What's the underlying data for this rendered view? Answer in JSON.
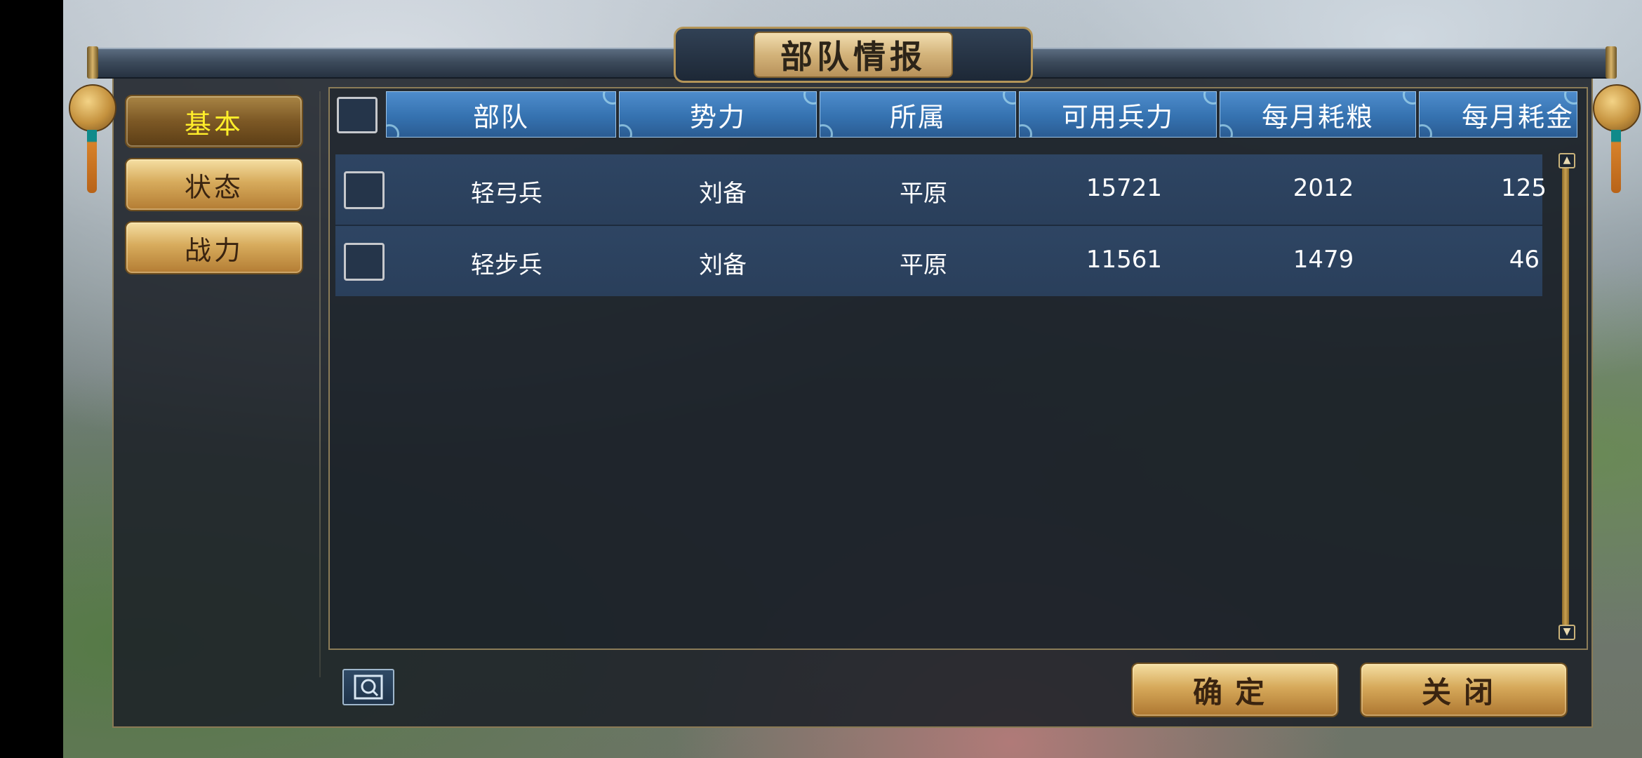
{
  "window": {
    "title": "部队情报"
  },
  "sidebar": {
    "tabs": [
      {
        "label": "基本",
        "active": true
      },
      {
        "label": "状态",
        "active": false
      },
      {
        "label": "战力",
        "active": false
      }
    ]
  },
  "table": {
    "headers": [
      "部队",
      "势力",
      "所属",
      "可用兵力",
      "每月耗粮",
      "每月耗金"
    ],
    "rows": [
      {
        "unit": "轻弓兵",
        "faction": "刘备",
        "location": "平原",
        "troops": "15721",
        "food": "2012",
        "gold": "125"
      },
      {
        "unit": "轻步兵",
        "faction": "刘备",
        "location": "平原",
        "troops": "11561",
        "food": "1479",
        "gold": "46"
      }
    ]
  },
  "footer": {
    "confirm_label": "确定",
    "close_label": "关闭"
  },
  "colors": {
    "active_tab_text": "#ffee2a",
    "header_blue": "#3572b0",
    "gold": "#d7ab5c"
  }
}
